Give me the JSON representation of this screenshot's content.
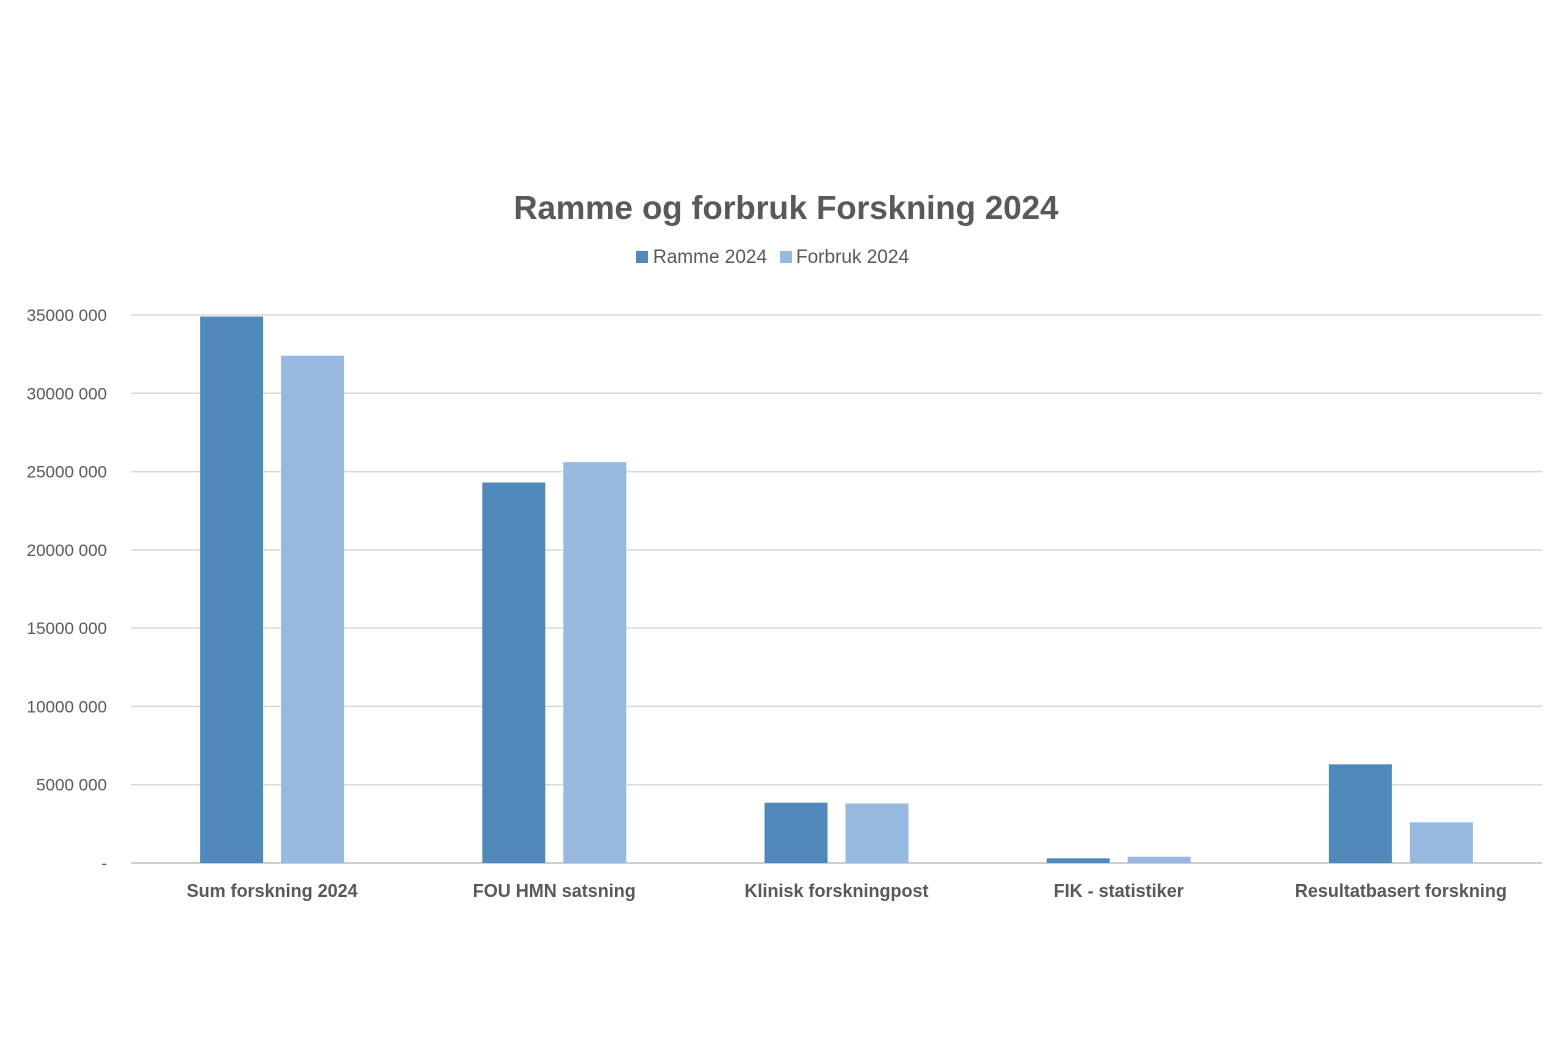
{
  "chart_data": {
    "type": "bar",
    "title": "Ramme og forbruk Forskning 2024",
    "xlabel": "",
    "ylabel": "",
    "categories": [
      "Sum forskning 2024",
      "FOU HMN satsning",
      "Klinisk forskningpost",
      "FIK - statistiker",
      "Resultatbasert forskning"
    ],
    "series": [
      {
        "name": "Ramme 2024",
        "color": "#4f88bb",
        "values": [
          34900000,
          24300000,
          3850000,
          300000,
          6300000
        ]
      },
      {
        "name": "Forbruk 2024",
        "color": "#98b9df",
        "values": [
          32400000,
          25600000,
          3800000,
          400000,
          2600000
        ]
      }
    ],
    "ylim": [
      0,
      35000000
    ],
    "yticks": [
      0,
      5000000,
      10000000,
      15000000,
      20000000,
      25000000,
      30000000,
      35000000
    ],
    "ytick_labels": [
      "-",
      "5000 000",
      "10000 000",
      "15000 000",
      "20000 000",
      "25000 000",
      "30000 000",
      "35000 000"
    ],
    "grid": true,
    "legend_position": "top-center"
  }
}
